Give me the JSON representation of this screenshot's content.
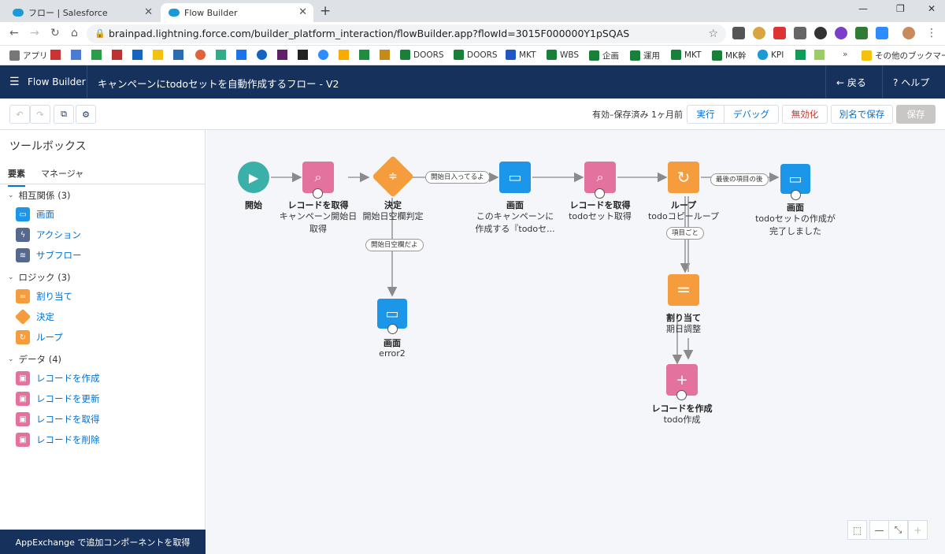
{
  "browser": {
    "tabs": [
      {
        "title": "フロー | Salesforce"
      },
      {
        "title": "Flow Builder"
      }
    ],
    "url": "brainpad.lightning.force.com/builder_platform_interaction/flowBuilder.app?flowId=3015F000000Y1pSQAS",
    "bookmarks": [
      "アプリ",
      "DOORS",
      "DOORS",
      "MKT",
      "WBS",
      "企画",
      "運用",
      "MKT",
      "MK幹",
      "KPI",
      "その他のブックマーク"
    ]
  },
  "header": {
    "app_name": "Flow Builder",
    "flow_title": "キャンペーンにtodoセットを自動作成するフロー - V2",
    "back_label": "戻る",
    "help_label": "ヘルプ"
  },
  "toolbar": {
    "status": "有効–保存済み 1ヶ月前",
    "run": "実行",
    "debug": "デバッグ",
    "deactivate": "無効化",
    "save_as": "別名で保存",
    "save": "保存"
  },
  "sidebar": {
    "title": "ツールボックス",
    "tabs": [
      "要素",
      "マネージャ"
    ],
    "sections": [
      {
        "label": "相互関係 (3)",
        "items": [
          "画面",
          "アクション",
          "サブフロー"
        ]
      },
      {
        "label": "ロジック (3)",
        "items": [
          "割り当て",
          "決定",
          "ループ"
        ]
      },
      {
        "label": "データ (4)",
        "items": [
          "レコードを作成",
          "レコードを更新",
          "レコードを取得",
          "レコードを削除"
        ]
      }
    ],
    "appexchange": "AppExchange で追加コンポーネントを取得"
  },
  "canvas": {
    "nodes": {
      "start": {
        "title": "開始",
        "sub": ""
      },
      "get1": {
        "title": "レコードを取得",
        "sub": "キャンペーン開始日\n取得"
      },
      "decision": {
        "title": "決定",
        "sub": "開始日空欄判定"
      },
      "screen1": {
        "title": "画面",
        "sub": "このキャンペーンに\n作成する『todoセ..."
      },
      "get2": {
        "title": "レコードを取得",
        "sub": "todoセット取得"
      },
      "loop": {
        "title": "ループ",
        "sub": "todoコピーループ"
      },
      "screen_done": {
        "title": "画面",
        "sub": "todoセットの作成が\n完了しました"
      },
      "screen_err": {
        "title": "画面",
        "sub": "error2"
      },
      "assign": {
        "title": "割り当て",
        "sub": "期日調整"
      },
      "create": {
        "title": "レコードを作成",
        "sub": "todo作成"
      }
    },
    "edge_labels": {
      "start_filled": "開始日入ってるよ",
      "start_empty": "開始日空欄だよ",
      "after_last": "最後の項目の後",
      "for_each": "項目ごと"
    }
  },
  "colors": {
    "header_bg": "#16325c",
    "screen": "#1b96e8",
    "record": "#e3739e",
    "logic": "#f59c3c",
    "start": "#3bb0a8"
  }
}
